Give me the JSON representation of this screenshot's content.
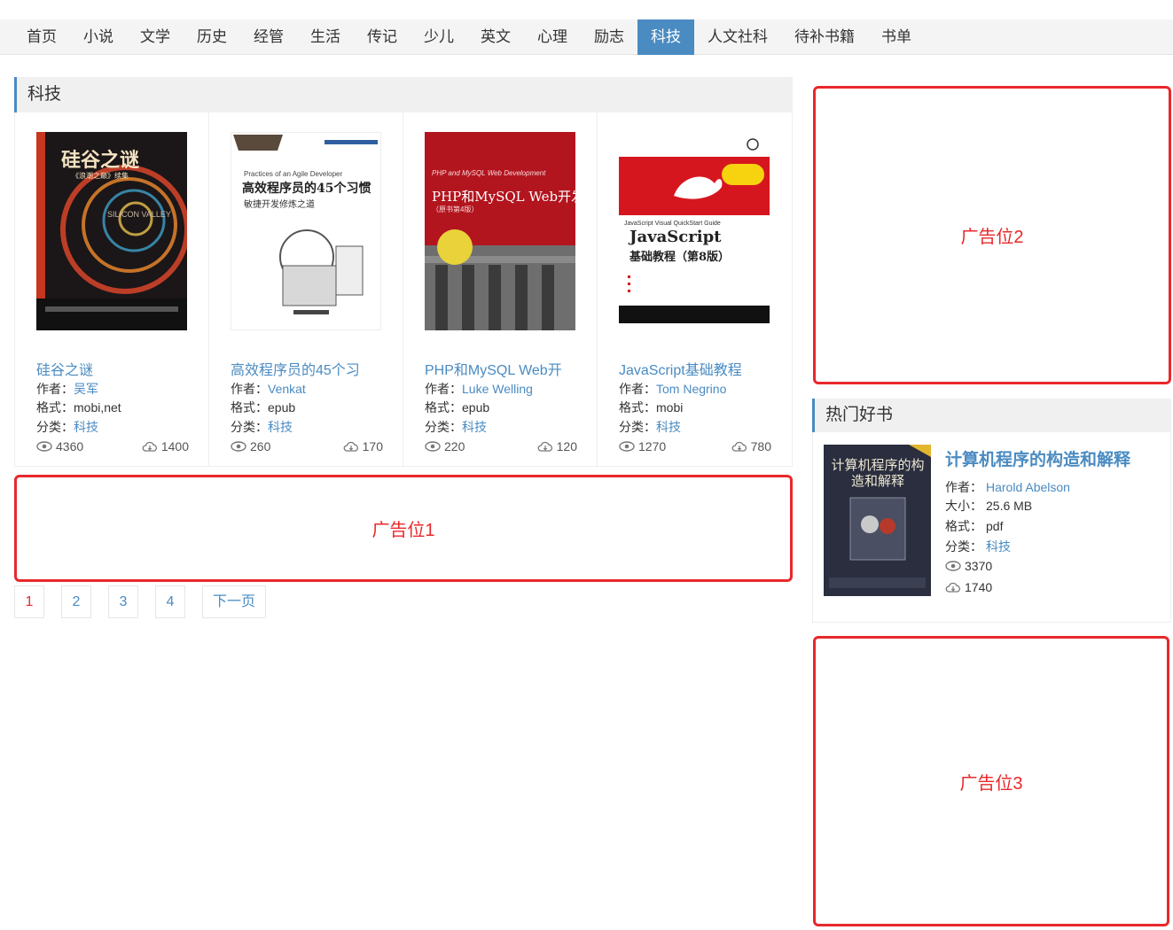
{
  "nav": {
    "items": [
      "首页",
      "小说",
      "文学",
      "历史",
      "经管",
      "生活",
      "传记",
      "少儿",
      "英文",
      "心理",
      "励志",
      "科技",
      "人文社科",
      "待补书籍",
      "书单"
    ],
    "active_index": 11
  },
  "section": {
    "title": "科技"
  },
  "labels": {
    "author": "作者：",
    "format": "格式：",
    "category": "分类：",
    "size": "大小："
  },
  "books": [
    {
      "title": "硅谷之谜",
      "author": "吴军",
      "format": "mobi,net",
      "category": "科技",
      "views": "4360",
      "downloads": "1400",
      "cover_title": "硅谷之谜",
      "cover_sub": "《浪潮之巅》续集",
      "cover_en": "SILICON VALLEY"
    },
    {
      "title": "高效程序员的45个习",
      "author": "Venkat",
      "format": "epub",
      "category": "科技",
      "views": "260",
      "downloads": "170",
      "cover_title": "高效程序员的45个习惯",
      "cover_sub": "敏捷开发修炼之道",
      "cover_en": "Practices of an Agile Developer"
    },
    {
      "title": "PHP和MySQL Web开",
      "author": "Luke Welling",
      "format": "epub",
      "category": "科技",
      "views": "220",
      "downloads": "120",
      "cover_title": "PHP和MySQL Web开发",
      "cover_sub": "（原书第4版）",
      "cover_en": "PHP and MySQL Web Development"
    },
    {
      "title": "JavaScript基础教程",
      "author": "Tom Negrino",
      "format": "mobi",
      "category": "科技",
      "views": "1270",
      "downloads": "780",
      "cover_title": "JavaScript",
      "cover_sub": "基础教程（第8版）",
      "cover_en": "JavaScript Visual QuickStart Guide"
    }
  ],
  "ads": {
    "ad1": "广告位1",
    "ad2": "广告位2",
    "ad3": "广告位3"
  },
  "pagination": {
    "pages": [
      "1",
      "2",
      "3",
      "4"
    ],
    "next": "下一页",
    "current": "1"
  },
  "hot": {
    "title": "热门好书",
    "book": {
      "title": "计算机程序的构造和解释",
      "author": "Harold Abelson",
      "size": "25.6 MB",
      "format": "pdf",
      "category": "科技",
      "views": "3370",
      "downloads": "1740",
      "cover_title": "计算机程序的构造和解释"
    }
  },
  "colors": {
    "accent": "#4a8bc2",
    "ad_border": "#e8282b",
    "nav_bg": "#f4f4f4"
  },
  "icons": {
    "views": "eye-icon",
    "downloads": "cloud-download-icon"
  }
}
